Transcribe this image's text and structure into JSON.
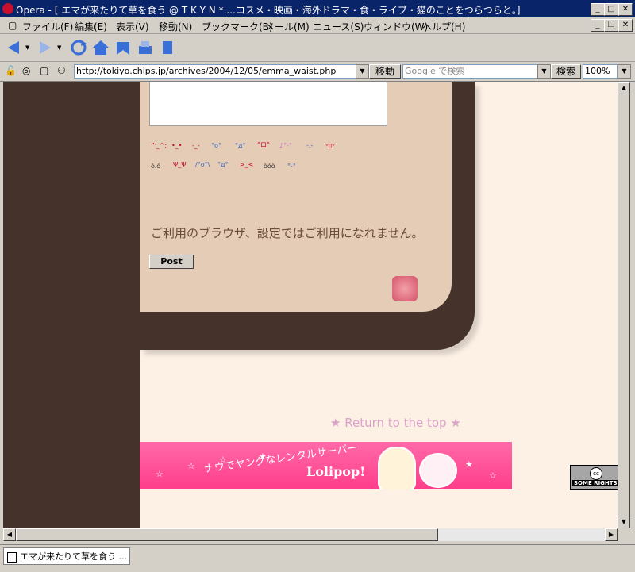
{
  "window": {
    "title": "Opera - [ エマが来たりて草を食う @ T K Y N *....コスメ・映画・海外ドラマ・食・ライブ・猫のことをつらつらと。]"
  },
  "menu": [
    {
      "label": "ファイル(F)"
    },
    {
      "label": "編集(E)"
    },
    {
      "label": "表示(V)"
    },
    {
      "label": "移動(N)"
    },
    {
      "label": "ブックマーク(B)"
    },
    {
      "label": "メール(M)"
    },
    {
      "label": "ニュース(S)"
    },
    {
      "label": "ウィンドウ(W)"
    },
    {
      "label": "ヘルプ(H)"
    }
  ],
  "address": {
    "url": "http://tokiyo.chips.jp/archives/2004/12/05/emma_waist.php",
    "go_label": "移動",
    "search_placeholder": "Google で検索",
    "search_label": "検索",
    "zoom": "100%"
  },
  "content": {
    "message": "ご利用のブラウザ、設定ではご利用になれません。",
    "post_label": "Post",
    "return_top": "★ Return to the top ★",
    "banner_line1": "ナウでヤングなレンタルサーバー",
    "banner_line2": "Lolipop!",
    "cc_text": "SOME RIGHTS RESERVED"
  },
  "tab": {
    "label": "エマが来たりて草を食う ..."
  }
}
